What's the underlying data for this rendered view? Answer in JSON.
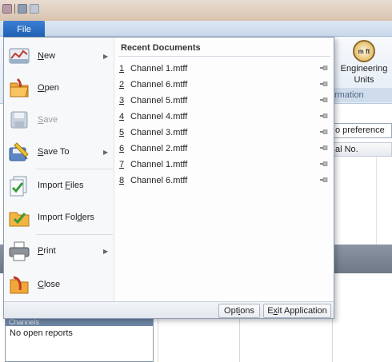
{
  "ribbon": {
    "file_tab": "File",
    "engineering_units_line1": "Engineering",
    "engineering_units_line2": "Units",
    "engineering_icon_text": "m ft",
    "group_label": "rmation",
    "preference_input": "o preference",
    "column_header": "al No."
  },
  "panel": {
    "title": "Channels",
    "text": "No open reports"
  },
  "menu": {
    "items": [
      {
        "accel": "N",
        "rest": "ew",
        "has_arrow": true,
        "enabled": true
      },
      {
        "accel": "O",
        "rest": "pen",
        "has_arrow": false,
        "enabled": true
      },
      {
        "accel": "S",
        "rest": "ave",
        "has_arrow": false,
        "enabled": false
      },
      {
        "accel": "S",
        "rest": "ave To",
        "has_arrow": true,
        "enabled": true
      },
      {
        "pre": "Import ",
        "accel": "F",
        "rest": "iles",
        "has_arrow": false,
        "enabled": true
      },
      {
        "pre": "Import Fol",
        "accel": "d",
        "rest": "ers",
        "has_arrow": false,
        "enabled": true
      },
      {
        "accel": "P",
        "rest": "rint",
        "has_arrow": true,
        "enabled": true
      },
      {
        "accel": "C",
        "rest": "lose",
        "has_arrow": false,
        "enabled": true
      }
    ],
    "recent_title": "Recent Documents",
    "recent": [
      {
        "num": "1",
        "name": "Channel 1.mtff"
      },
      {
        "num": "2",
        "name": "Channel 6.mtff"
      },
      {
        "num": "3",
        "name": "Channel 5.mtff"
      },
      {
        "num": "4",
        "name": "Channel 4.mtff"
      },
      {
        "num": "5",
        "name": "Channel 3.mtff"
      },
      {
        "num": "6",
        "name": "Channel 2.mtff"
      },
      {
        "num": "7",
        "name": "Channel 1.mtff"
      },
      {
        "num": "8",
        "name": "Channel 6.mtff"
      }
    ],
    "options_pre": "Opt",
    "options_accel": "i",
    "options_rest": "ons",
    "exit_pre": "E",
    "exit_accel": "x",
    "exit_rest": "it Application"
  },
  "icons": {
    "new": "new-icon",
    "open": "open-folder-icon",
    "save": "save-icon",
    "save_to": "save-to-icon",
    "import_files": "import-files-icon",
    "import_folders": "import-folders-icon",
    "print": "printer-icon",
    "close": "close-folder-icon",
    "pin": "pin-icon"
  }
}
